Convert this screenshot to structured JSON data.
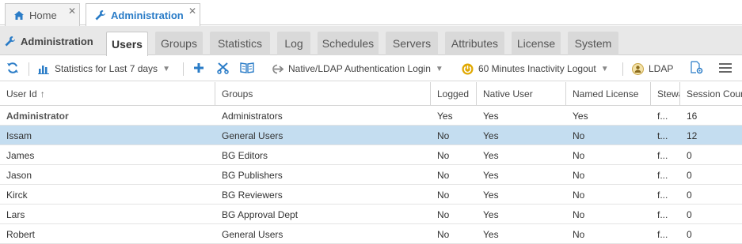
{
  "doc_tabs": {
    "home": {
      "label": "Home",
      "close": "✕"
    },
    "admin": {
      "label": "Administration",
      "close": "✕"
    }
  },
  "section": {
    "title": "Administration"
  },
  "sub_tabs": [
    "Users",
    "Groups",
    "Statistics",
    "Log",
    "Schedules",
    "Servers",
    "Attributes",
    "License",
    "System"
  ],
  "active_sub_tab": "Users",
  "toolbar": {
    "stats_label": "Statistics for Last 7 days",
    "auth_label": "Native/LDAP Authentication Login",
    "inactivity_label": "60 Minutes Inactivity Logout",
    "ldap_label": "LDAP"
  },
  "columns": [
    "User Id",
    "Groups",
    "Logged",
    "Native User",
    "Named License",
    "Steward",
    "Session Count"
  ],
  "sort_indicator": "↑",
  "rows": [
    {
      "user": "Administrator",
      "group": "Administrators",
      "logged": "Yes",
      "native": "Yes",
      "named": "Yes",
      "steward": "f...",
      "sessions": "16"
    },
    {
      "user": "Issam",
      "group": "General Users",
      "logged": "No",
      "native": "Yes",
      "named": "No",
      "steward": "t...",
      "sessions": "12"
    },
    {
      "user": "James",
      "group": "BG Editors",
      "logged": "No",
      "native": "Yes",
      "named": "No",
      "steward": "f...",
      "sessions": "0"
    },
    {
      "user": "Jason",
      "group": "BG Publishers",
      "logged": "No",
      "native": "Yes",
      "named": "No",
      "steward": "f...",
      "sessions": "0"
    },
    {
      "user": "Kirck",
      "group": "BG Reviewers",
      "logged": "No",
      "native": "Yes",
      "named": "No",
      "steward": "f...",
      "sessions": "0"
    },
    {
      "user": "Lars",
      "group": "BG Approval Dept",
      "logged": "No",
      "native": "Yes",
      "named": "No",
      "steward": "f...",
      "sessions": "0"
    },
    {
      "user": "Robert",
      "group": "General Users",
      "logged": "No",
      "native": "Yes",
      "named": "No",
      "steward": "f...",
      "sessions": "0"
    }
  ],
  "colors": {
    "accent": "#2a7cc7",
    "selected_row": "#c4ddf0",
    "power_icon": "#e0a800"
  }
}
